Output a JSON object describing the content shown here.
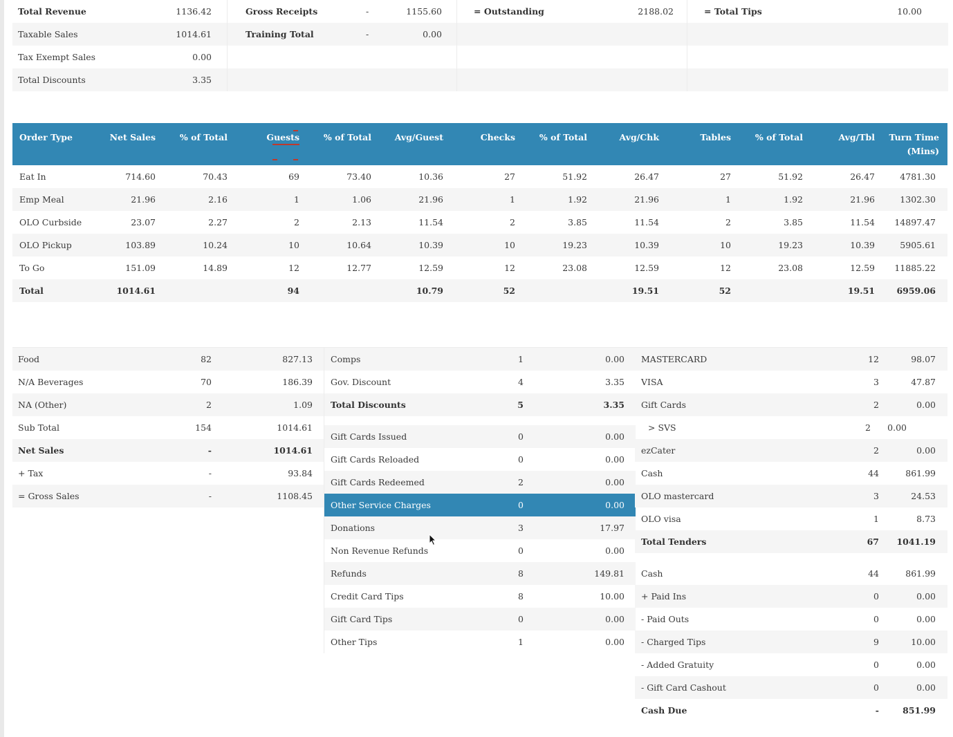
{
  "summary": {
    "col1": [
      {
        "label": "Total Revenue",
        "value": "1136.42",
        "bold": true
      },
      {
        "label": "Taxable Sales",
        "value": "1014.61"
      },
      {
        "label": "Tax Exempt Sales",
        "value": "0.00"
      },
      {
        "label": "Total Discounts",
        "value": "3.35"
      }
    ],
    "col2": [
      {
        "label": "Gross Receipts",
        "mid": "-",
        "value": "1155.60",
        "bold": true
      },
      {
        "label": "Training Total",
        "mid": "-",
        "value": "0.00",
        "bold": true
      }
    ],
    "col3": [
      {
        "label": "= Outstanding",
        "value": "2188.02",
        "bold": true
      }
    ],
    "col4": [
      {
        "label": "= Total Tips",
        "value": "10.00",
        "bold": true
      }
    ]
  },
  "order_table": {
    "headers": [
      "Order Type",
      "Net Sales",
      "% of Total",
      "Guests",
      "% of Total",
      "Avg/Guest",
      "Checks",
      "% of Total",
      "Avg/Chk",
      "Tables",
      "% of Total",
      "Avg/Tbl",
      "Turn Time"
    ],
    "turn_time_sub": "(Mins)",
    "sorted_column": "Guests",
    "rows": [
      [
        "Eat In",
        "714.60",
        "70.43",
        "69",
        "73.40",
        "10.36",
        "27",
        "51.92",
        "26.47",
        "27",
        "51.92",
        "26.47",
        "4781.30"
      ],
      [
        "Emp Meal",
        "21.96",
        "2.16",
        "1",
        "1.06",
        "21.96",
        "1",
        "1.92",
        "21.96",
        "1",
        "1.92",
        "21.96",
        "1302.30"
      ],
      [
        "OLO Curbside",
        "23.07",
        "2.27",
        "2",
        "2.13",
        "11.54",
        "2",
        "3.85",
        "11.54",
        "2",
        "3.85",
        "11.54",
        "14897.47"
      ],
      [
        "OLO Pickup",
        "103.89",
        "10.24",
        "10",
        "10.64",
        "10.39",
        "10",
        "19.23",
        "10.39",
        "10",
        "19.23",
        "10.39",
        "5905.61"
      ],
      [
        "To Go",
        "151.09",
        "14.89",
        "12",
        "12.77",
        "12.59",
        "12",
        "23.08",
        "12.59",
        "12",
        "23.08",
        "12.59",
        "11885.22"
      ]
    ],
    "total": [
      "Total",
      "1014.61",
      "",
      "94",
      "",
      "10.79",
      "52",
      "",
      "19.51",
      "52",
      "",
      "19.51",
      "6959.06"
    ]
  },
  "sales_categories": [
    {
      "label": "Food",
      "count": "82",
      "amount": "827.13"
    },
    {
      "label": "N/A Beverages",
      "count": "70",
      "amount": "186.39"
    },
    {
      "label": "NA (Other)",
      "count": "2",
      "amount": "1.09"
    },
    {
      "label": "Sub Total",
      "count": "154",
      "amount": "1014.61"
    },
    {
      "label": "Net Sales",
      "count": "-",
      "amount": "1014.61",
      "bold": true
    },
    {
      "label": "+ Tax",
      "count": "-",
      "amount": "93.84"
    },
    {
      "label": "= Gross Sales",
      "count": "-",
      "amount": "1108.45"
    }
  ],
  "discounts": [
    {
      "label": "Comps",
      "count": "1",
      "amount": "0.00"
    },
    {
      "label": "Gov. Discount",
      "count": "4",
      "amount": "3.35"
    },
    {
      "label": "Total Discounts",
      "count": "5",
      "amount": "3.35",
      "bold": true
    }
  ],
  "other_items": [
    {
      "label": "Gift Cards Issued",
      "count": "0",
      "amount": "0.00"
    },
    {
      "label": "Gift Cards Reloaded",
      "count": "0",
      "amount": "0.00"
    },
    {
      "label": "Gift Cards Redeemed",
      "count": "2",
      "amount": "0.00"
    },
    {
      "label": "Other Service Charges",
      "count": "0",
      "amount": "0.00",
      "highlight": true
    },
    {
      "label": "Donations",
      "count": "3",
      "amount": "17.97"
    },
    {
      "label": "Non Revenue Refunds",
      "count": "0",
      "amount": "0.00"
    },
    {
      "label": "Refunds",
      "count": "8",
      "amount": "149.81"
    },
    {
      "label": "Credit Card Tips",
      "count": "8",
      "amount": "10.00"
    },
    {
      "label": "Gift Card Tips",
      "count": "0",
      "amount": "0.00"
    },
    {
      "label": "Other Tips",
      "count": "1",
      "amount": "0.00"
    }
  ],
  "tenders": [
    {
      "label": "MASTERCARD",
      "count": "12",
      "amount": "98.07"
    },
    {
      "label": "VISA",
      "count": "3",
      "amount": "47.87"
    },
    {
      "label": "Gift Cards",
      "count": "2",
      "amount": "0.00"
    },
    {
      "label": "> SVS",
      "count": "2",
      "amount": "0.00",
      "sub": true
    },
    {
      "label": "ezCater",
      "count": "2",
      "amount": "0.00"
    },
    {
      "label": "Cash",
      "count": "44",
      "amount": "861.99"
    },
    {
      "label": "OLO mastercard",
      "count": "3",
      "amount": "24.53"
    },
    {
      "label": "OLO visa",
      "count": "1",
      "amount": "8.73"
    },
    {
      "label": "Total Tenders",
      "count": "67",
      "amount": "1041.19",
      "bold": true
    }
  ],
  "cash": [
    {
      "label": "Cash",
      "count": "44",
      "amount": "861.99"
    },
    {
      "label": "+ Paid Ins",
      "count": "0",
      "amount": "0.00"
    },
    {
      "label": "- Paid Outs",
      "count": "0",
      "amount": "0.00"
    },
    {
      "label": "- Charged Tips",
      "count": "9",
      "amount": "10.00"
    },
    {
      "label": "- Added Gratuity",
      "count": "0",
      "amount": "0.00"
    },
    {
      "label": "- Gift Card Cashout",
      "count": "0",
      "amount": "0.00"
    },
    {
      "label": "Cash Due",
      "count": "-",
      "amount": "851.99",
      "bold": true
    }
  ]
}
